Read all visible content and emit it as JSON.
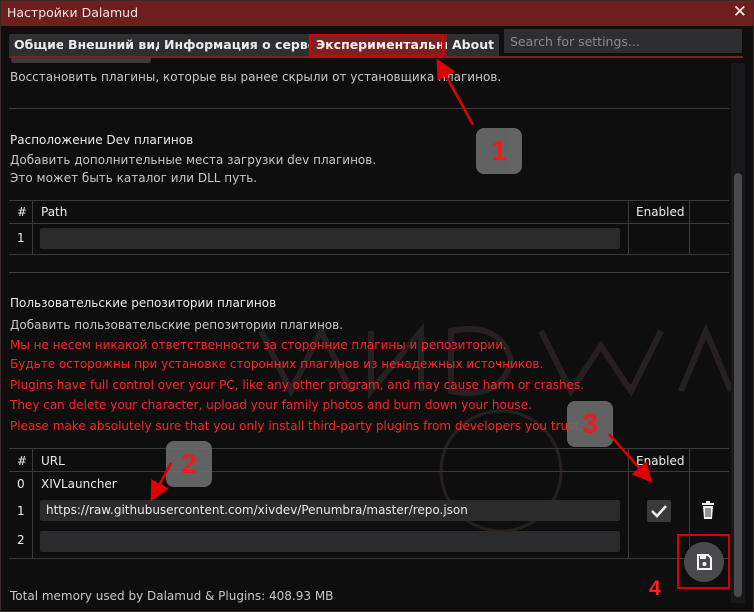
{
  "window": {
    "title": "Настройки Dalamud",
    "close_label": "✕"
  },
  "tabs": [
    {
      "label": "Общие"
    },
    {
      "label": "Внешний вид"
    },
    {
      "label": "Информация о сервере"
    },
    {
      "label": "Экспериментальные",
      "active": true
    },
    {
      "label": "About"
    }
  ],
  "search": {
    "placeholder": "Search for settings...",
    "value": ""
  },
  "hidden_plugins": {
    "description": "Восстановить плагины, которые вы ранее скрыли от установщика плагинов."
  },
  "dev_plugins": {
    "heading": "Расположение Dev плагинов",
    "description_line1": "Добавить дополнительные места загрузки dev плагинов.",
    "description_line2": "Это может быть каталог или DLL путь.",
    "columns": {
      "num": "#",
      "path": "Path",
      "enabled": "Enabled"
    },
    "rows": [
      {
        "num": "1",
        "path": ""
      }
    ]
  },
  "custom_repos": {
    "heading": "Пользовательские репозитории плагинов",
    "description": "Добавить пользовательские репозитории плагинов.",
    "warnings": [
      "Мы не несем никакой ответственности за сторонние плагины и репозитории.",
      "Будьте осторожны при установке сторонних плагинов из ненадежных источников.",
      "Plugins have full control over your PC, like any other program, and may cause harm or crashes.",
      "They can delete your character, upload your family photos and burn down your house.",
      "Please make absolutely sure that you only install third-party plugins from developers you trust."
    ],
    "columns": {
      "num": "#",
      "url": "URL",
      "enabled": "Enabled"
    },
    "rows": [
      {
        "num": "0",
        "url": "XIVLauncher"
      },
      {
        "num": "1",
        "url": "https://raw.githubusercontent.com/xivdev/Penumbra/master/repo.json",
        "enabled": true
      },
      {
        "num": "2",
        "url": ""
      }
    ]
  },
  "footer": {
    "memory": "Total memory used by Dalamud & Plugins: 408.93 MB"
  },
  "icons": {
    "check": "checkmark-icon",
    "trash": "trash-icon",
    "save": "save-icon"
  },
  "annotations": {
    "badge1": "1",
    "badge2": "2",
    "badge3": "3",
    "badge4": "4"
  },
  "colors": {
    "accent": "#7a2121",
    "title_bar": "#6d1f1d",
    "warning": "#ff2323",
    "annotation": "#d90000"
  }
}
